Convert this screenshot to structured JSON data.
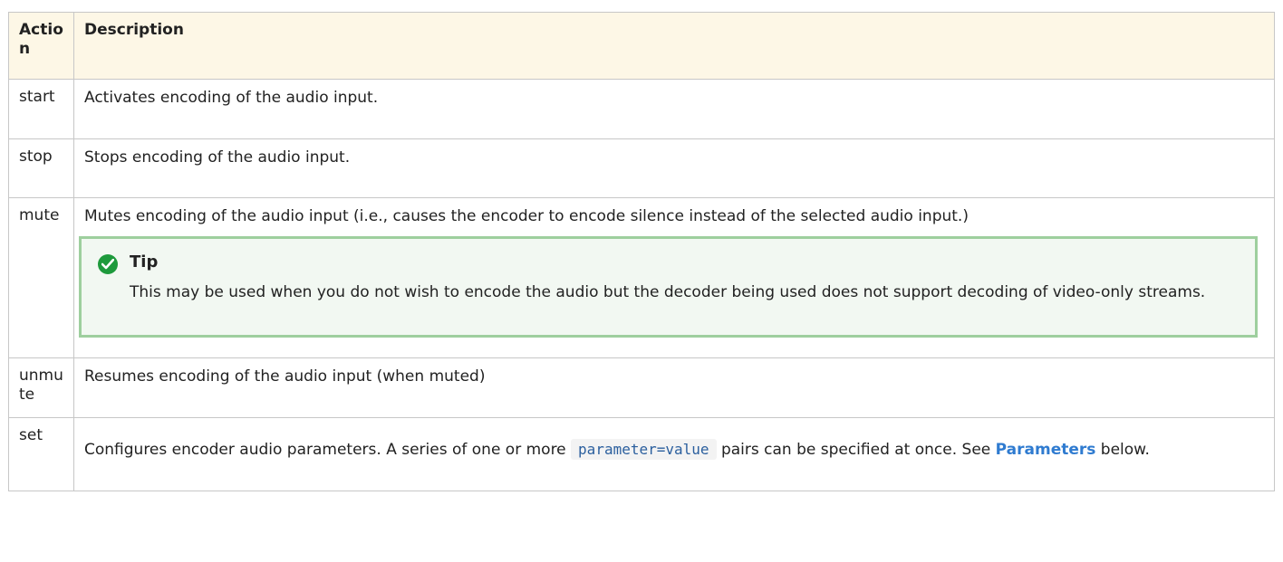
{
  "table": {
    "header": {
      "action": "Action",
      "description": "Description"
    },
    "rows": [
      {
        "action": "start",
        "description": "Activates encoding of the audio input."
      },
      {
        "action": "stop",
        "description": "Stops encoding of the audio input."
      },
      {
        "action": "mute",
        "description": "Mutes encoding of the audio input (i.e., causes the encoder to encode silence instead of the selected audio input.)",
        "tip": {
          "title": "Tip",
          "body": "This may be used when you do not wish to encode the audio but the decoder being used does not support decoding of video-only streams."
        }
      },
      {
        "action": "unmute",
        "description": "Resumes encoding of the audio input (when muted)"
      },
      {
        "action": "set",
        "description_before": "Configures encoder audio parameters. A series of one or more ",
        "code": "parameter=value",
        "description_mid": " pairs can be specified at once. See ",
        "link": "Parameters",
        "description_after": " below."
      }
    ]
  },
  "colors": {
    "header_bg": "#fdf7e6",
    "tip_border": "#9ecf9e",
    "tip_bg": "#f2f8f2",
    "tip_icon": "#1e9a3c",
    "link": "#2f7bd0"
  }
}
